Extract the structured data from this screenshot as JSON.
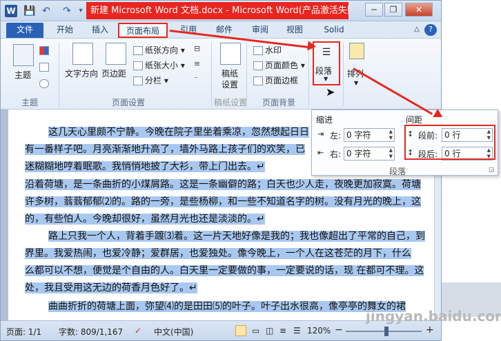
{
  "title": "新建 Microsoft Word 文档.docx - Microsoft Word(产品激活失败)",
  "quick_access": {
    "logo": "W",
    "save": "💾",
    "undo": "↶",
    "redo": "↷",
    "customize": "▾"
  },
  "window_buttons": {
    "minimize": "─",
    "restore": "❐",
    "close": "✕"
  },
  "tabs": [
    "文件",
    "开始",
    "插入",
    "页面布局",
    "引用",
    "邮件",
    "审阅",
    "视图",
    "Solid"
  ],
  "ribbon_right": {
    "collapse": "△",
    "help": "?"
  },
  "groups": {
    "theme": {
      "label": "主题",
      "buttons": [
        "主题"
      ]
    },
    "page_setup": {
      "label": "页面设置",
      "text_direction": "文字方向",
      "margins": "页边距",
      "paper_direction": "纸张方向 ▾",
      "paper_size": "纸张大小 ▾",
      "columns": "分栏 ▾"
    },
    "manuscript": {
      "label": "稿纸设置",
      "line1": "稿纸",
      "line2": "设置"
    },
    "page_background": {
      "label": "页面背景",
      "watermark": "水印",
      "page_color": "页面颜色 ▾",
      "page_border": "页面边框"
    },
    "paragraph": {
      "label": "段落"
    },
    "arrange": {
      "label": "排列"
    }
  },
  "paragraph_popup": {
    "indent_title": "缩进",
    "spacing_title": "间距",
    "left_label": "左:",
    "left_value": "0 字符",
    "right_label": "右:",
    "right_value": "0 字符",
    "before_label": "段前:",
    "before_value": "0 行",
    "after_label": "段后:",
    "after_value": "0 行",
    "footer": "段落"
  },
  "document_lines": [
    "这几天心里颇不宁静。今晚在院子里坐着乘凉，忽然想起日日",
    "有一番样子吧。月亮渐渐地升高了，墙外马路上孩子们的欢笑，已",
    "迷糊糊地哼着眠歌。我悄悄地披了大衫，带上门出去。↵",
    "沿着荷塘，是一条曲折的小煤屑路。这是一条幽僻的路；白天也少人走，夜晚更加寂寞。荷塘",
    "许多树，蓊蓊郁郁⑵的。路的一旁，是些杨柳，和一些不知道名字的树。没有月光的晚上，这",
    "的，有些怕人。今晚却很好，虽然月光也还是淡淡的。↵",
    "路上只我一个人，背着手踱⑶着。这一片天地好像是我的；我也像超出了平常的自己，到",
    "界里。我爱热闹，也爱冷静；爱群居，也爱独处。像今晚上，一个人在这苍茫的月下，什么",
    "么都可以不想，便觉是个自由的人。白天里一定要做的事，一定要说的话，现 在都可不理。这",
    "处，我且受用这无边的荷香月色好了。↵",
    "曲曲折折的荷塘上面，弥望⑷的是田田⑸的叶子。叶子出水很高，像亭亭的舞女的裙"
  ],
  "status": {
    "page": "页面: 1/1",
    "words": "字数: 809/1,167",
    "language": "中文(中国)",
    "zoom": "120%",
    "zoom_minus": "−",
    "zoom_plus": "+"
  },
  "watermark_text": "jingyan.baidu.com",
  "colors": {
    "accent": "#e8251f",
    "file_tab": "#2b62b8",
    "highlight": "#a9c8ef"
  }
}
